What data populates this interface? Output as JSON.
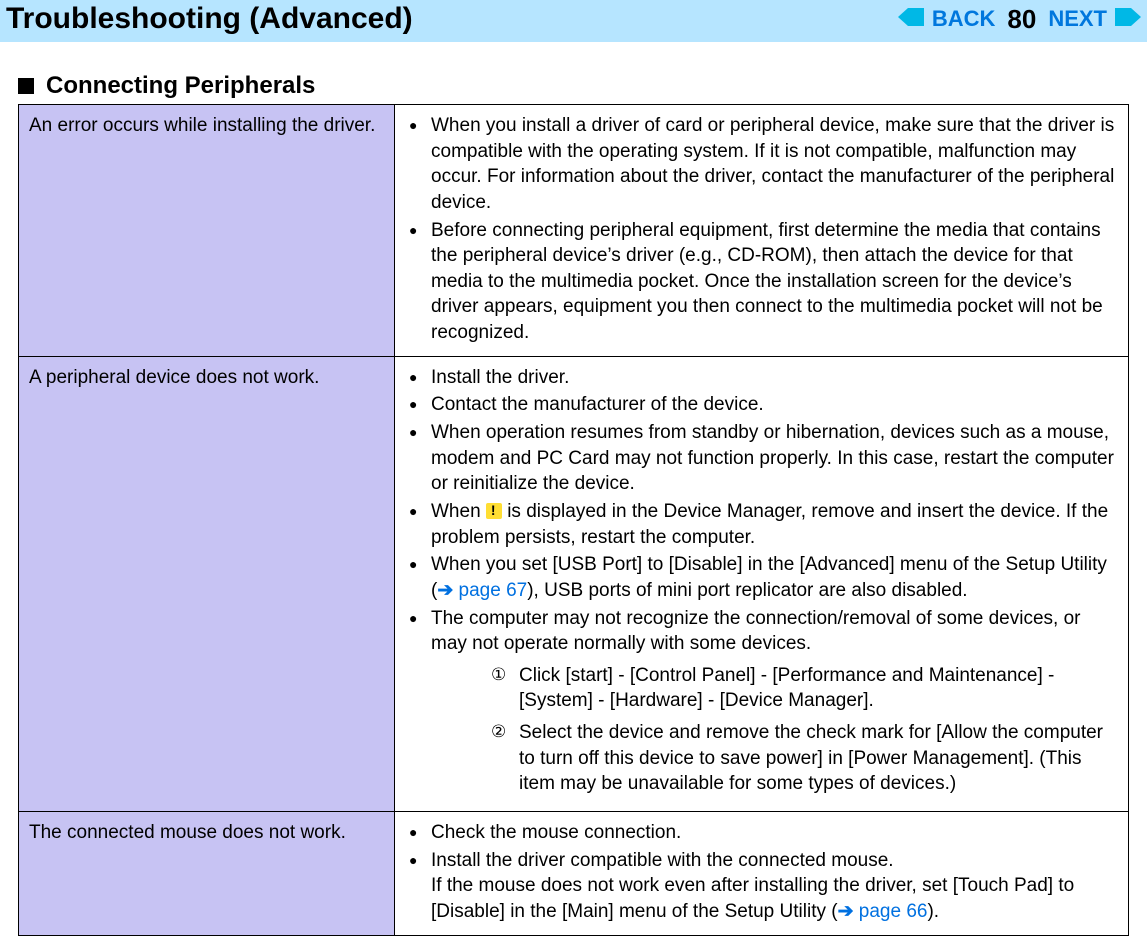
{
  "header": {
    "title": "Troubleshooting (Advanced)",
    "back_label": "BACK",
    "next_label": "NEXT",
    "page_number": "80"
  },
  "section": {
    "heading": "Connecting Peripherals"
  },
  "rows": [
    {
      "problem": "An error occurs while installing the driver.",
      "solutions": [
        "When you install a driver of card or peripheral device, make sure that the driver is compatible with the operating system. If it is not compatible, malfunction may occur. For information about the driver, contact the manufacturer of the peripheral device.",
        "Before connecting peripheral equipment, first determine the media that contains the peripheral device’s driver (e.g., CD-ROM), then attach the device for that media to the multimedia pocket. Once the installation screen for the device’s driver appears, equipment you then connect to the multimedia pocket will not be recognized."
      ]
    },
    {
      "problem": "A peripheral device does not work.",
      "solutions_a": [
        "Install the driver.",
        "Contact the manufacturer of the device.",
        "When operation resumes from standby or hibernation, devices such as a mouse, modem and PC Card may not function properly. In this case, restart the computer or reinitialize the device."
      ],
      "warn_pre": "When ",
      "warn_post": " is displayed in the Device Manager, remove and insert the device. If the problem persists, restart the computer.",
      "usb_pre": "When you set [USB Port] to [Disable] in the [Advanced] menu of the Setup Utility (",
      "usb_link": "page 67",
      "usb_post": "), USB ports of mini port replicator are also disabled.",
      "recognize_text": "The computer may not recognize the connection/removal of some devices, or may not operate normally with some devices.",
      "steps": [
        {
          "num": "①",
          "text": "Click [start] - [Control Panel] - [Performance and Maintenance] - [System] - [Hardware] - [Device Manager]."
        },
        {
          "num": "②",
          "text": "Select the device and remove the check mark for [Allow the computer to turn off this device to save power] in [Power Management]. (This item may be unavailable for some types of devices.)"
        }
      ]
    },
    {
      "problem": "The connected mouse does not work.",
      "sol1": "Check the mouse connection.",
      "sol2_pre": "Install the driver compatible with the connected mouse.\nIf the mouse does not work even after installing the driver, set [Touch Pad] to [Disable] in the [Main] menu of the Setup Utility (",
      "sol2_link": "page 66",
      "sol2_post": ")."
    }
  ]
}
